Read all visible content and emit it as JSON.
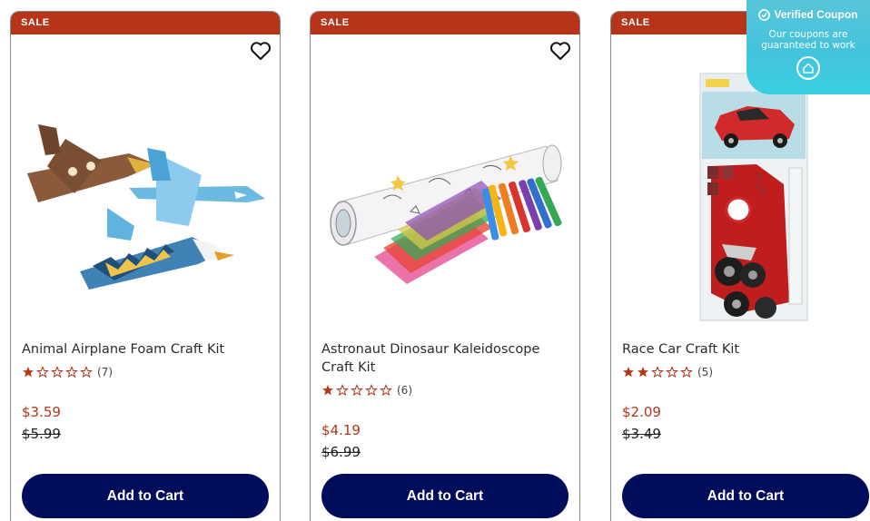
{
  "colors": {
    "sale_red": "#b5341a",
    "cart_navy": "#000d5b",
    "coupon_teal": "#43c3dd",
    "star": "#b5341a"
  },
  "products": [
    {
      "badge": "SALE",
      "title": "Animal Airplane Foam Craft Kit",
      "rating": 1,
      "rating_max": 5,
      "review_count": "(7)",
      "price": "$3.59",
      "original_price": "$5.99",
      "cart_label": "Add to Cart",
      "favorite_icon": "heart-outline-icon"
    },
    {
      "badge": "SALE",
      "title": "Astronaut Dinosaur Kaleidoscope Craft Kit",
      "rating": 1,
      "rating_max": 5,
      "review_count": "(6)",
      "price": "$4.19",
      "original_price": "$6.99",
      "cart_label": "Add to Cart",
      "favorite_icon": "heart-outline-icon"
    },
    {
      "badge": "SALE",
      "title": "Race Car Craft Kit",
      "rating": 2,
      "rating_max": 5,
      "review_count": "(5)",
      "price": "$2.09",
      "original_price": "$3.49",
      "cart_label": "Add to Cart",
      "favorite_icon": "heart-outline-icon"
    }
  ],
  "coupon": {
    "title": "Verified Coupon",
    "subtitle_line1": "Our coupons are",
    "subtitle_line2": "guaranteed to work",
    "icon": "check-circle-icon",
    "logo_icon": "house-logo-icon"
  }
}
